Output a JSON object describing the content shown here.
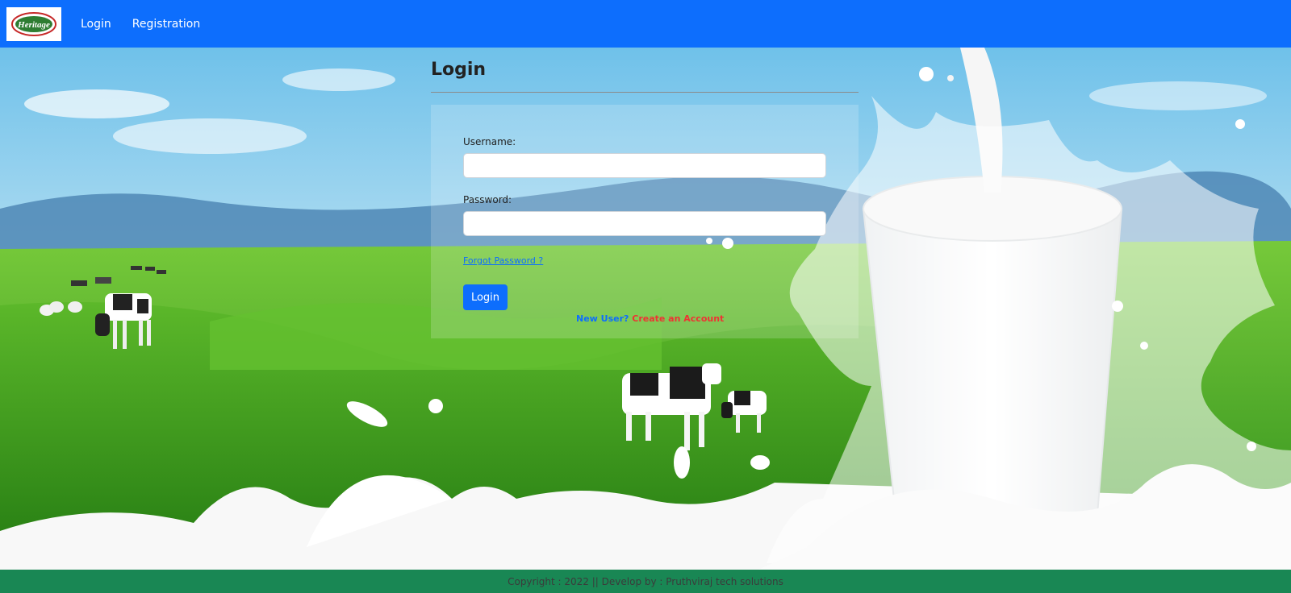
{
  "navbar": {
    "logo_text": "Heritage",
    "links": [
      {
        "label": "Login"
      },
      {
        "label": "Registration"
      }
    ],
    "colors": {
      "bar": "#0d6efd"
    }
  },
  "login": {
    "title": "Login",
    "username_label": "Username:",
    "username_value": "",
    "password_label": "Password:",
    "password_value": "",
    "forgot_label": "Forgot Password ?",
    "submit_label": "Login",
    "new_user_label": "New User?",
    "create_account_label": "Create an Account"
  },
  "footer": {
    "text": "Copyright : 2022 || Develop by : Pruthviraj tech solutions"
  }
}
